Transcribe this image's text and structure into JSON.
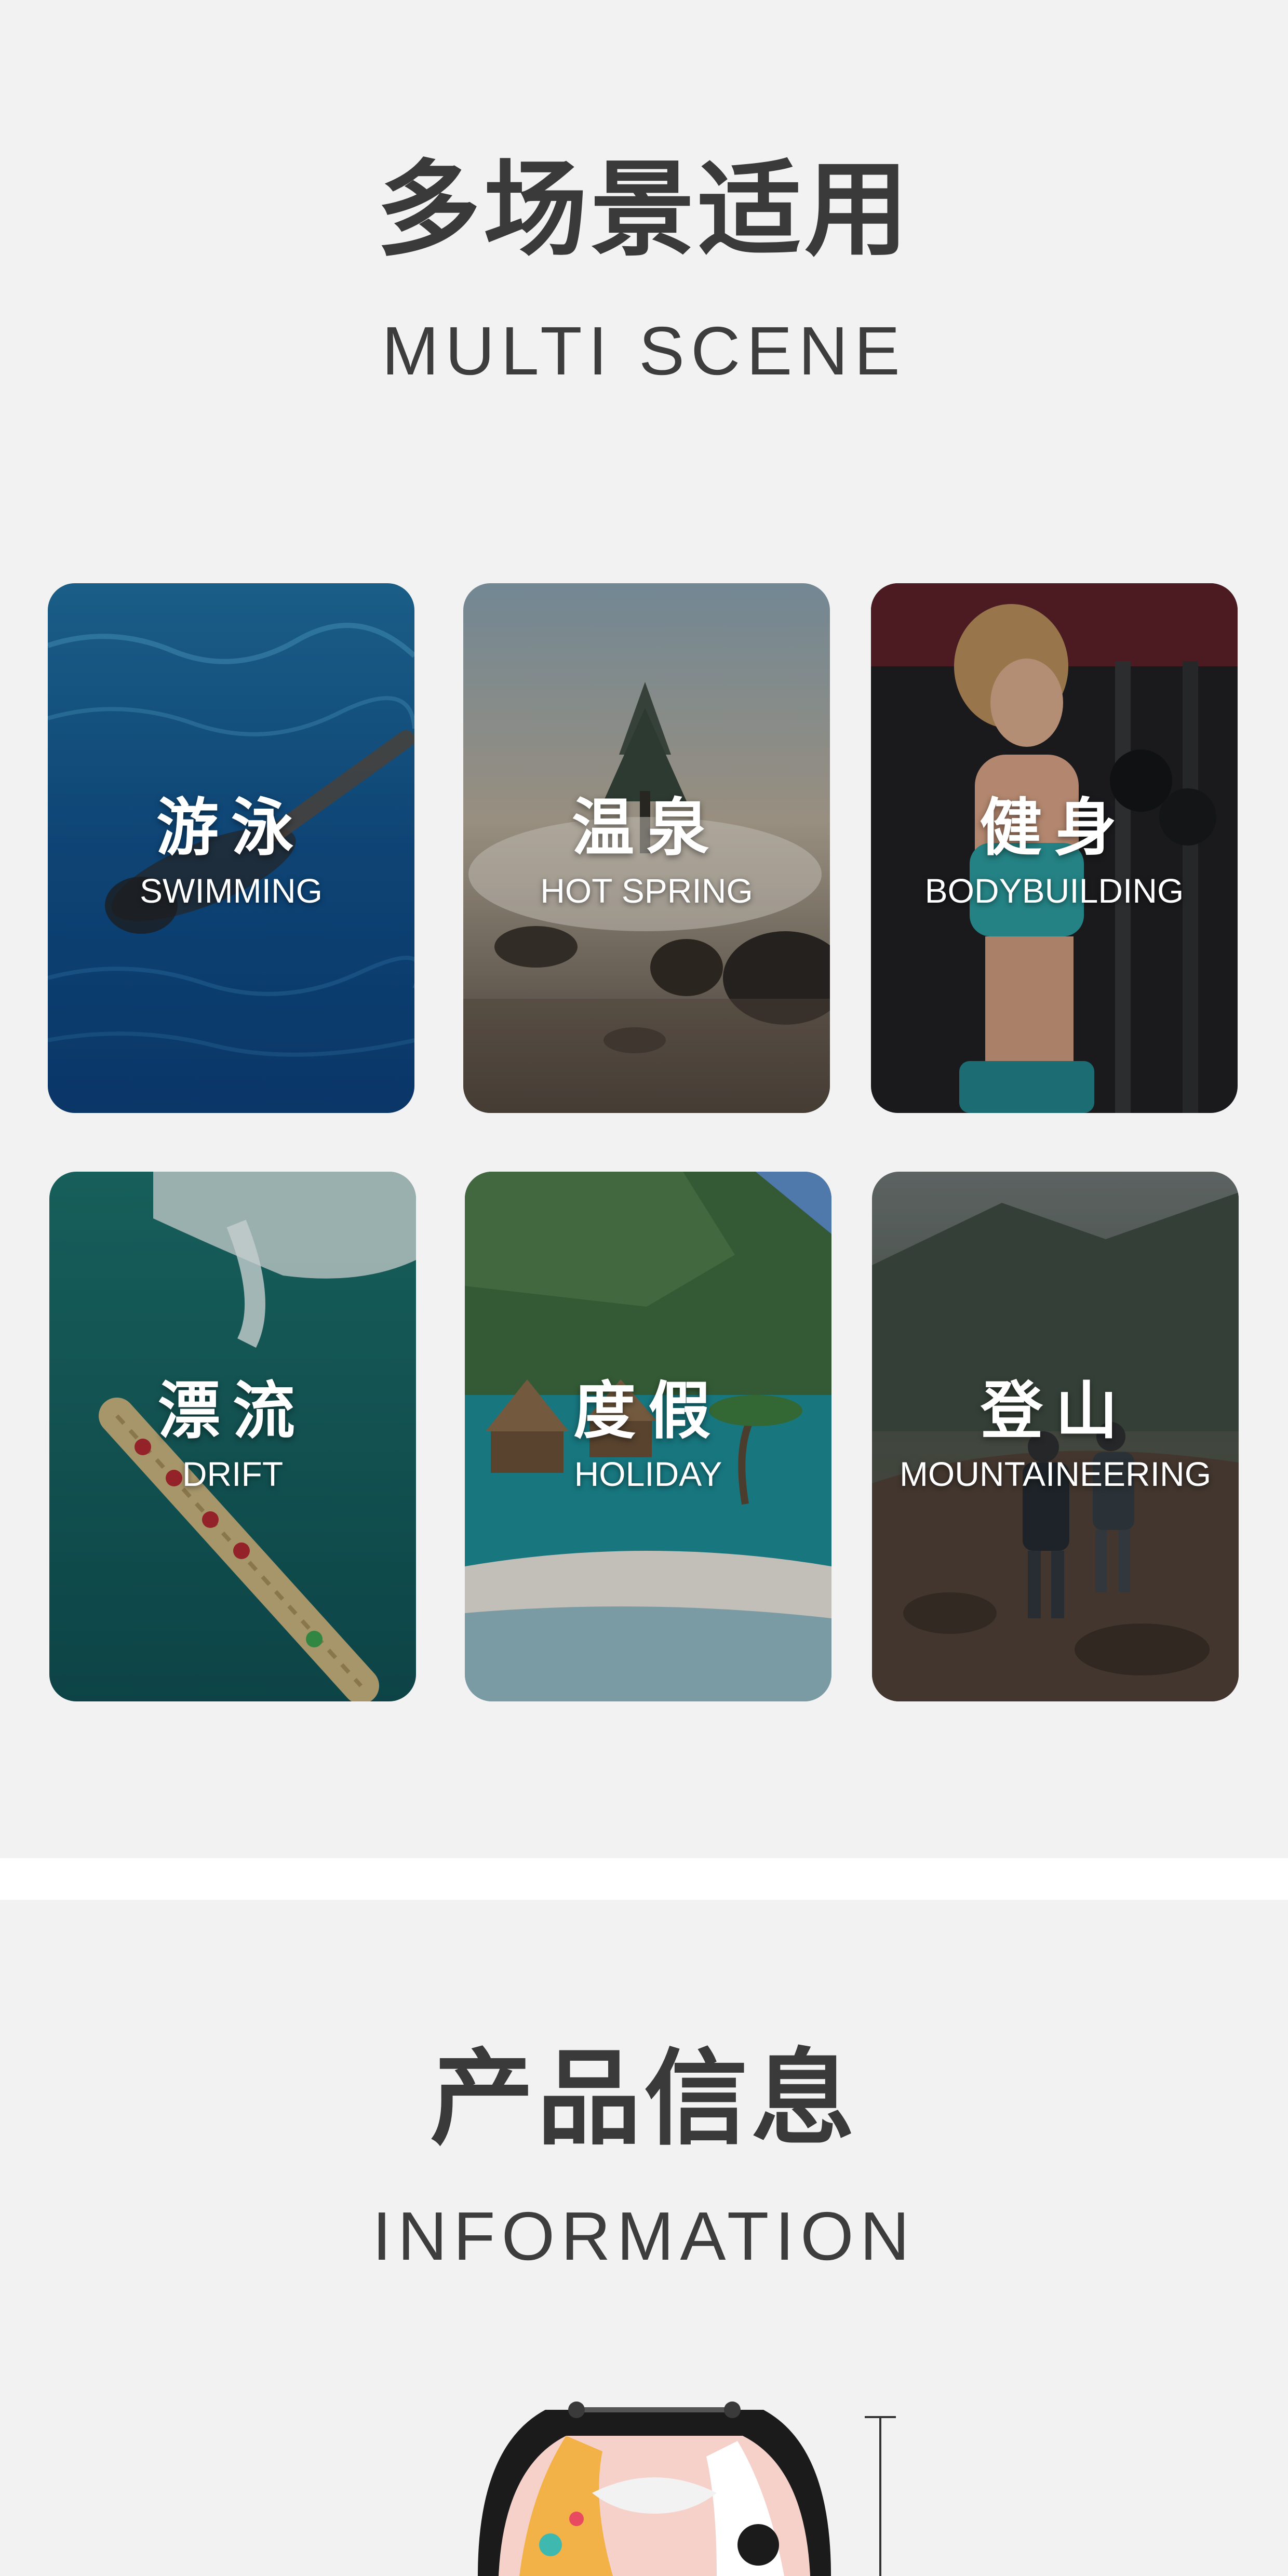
{
  "scene_section": {
    "title_zh": "多场景适用",
    "title_en": "MULTI SCENE",
    "cards": [
      {
        "label_zh": "游泳",
        "label_en": "SWIMMING",
        "image": "swimmer-in-pool"
      },
      {
        "label_zh": "温泉",
        "label_en": "HOT SPRING",
        "image": "misty-hot-spring-with-rocks"
      },
      {
        "label_zh": "健身",
        "label_en": "BODYBUILDING",
        "image": "woman-lifting-dumbbells"
      },
      {
        "label_zh": "漂流",
        "label_en": "DRIFT",
        "image": "bamboo-raft-by-waterfall"
      },
      {
        "label_zh": "度假",
        "label_en": "HOLIDAY",
        "image": "tropical-overwater-bungalows"
      },
      {
        "label_zh": "登山",
        "label_en": "MOUNTAINEERING",
        "image": "hikers-on-mountain-trail"
      }
    ]
  },
  "info_section": {
    "title_zh": "产品信息",
    "title_en": "INFORMATION",
    "product_image": "patterned-drawstring-bag"
  },
  "colors": {
    "page_background": "#f2f2f2",
    "divider": "#ffffff",
    "heading_text": "#3a3a3a",
    "card_text": "#ffffff"
  }
}
